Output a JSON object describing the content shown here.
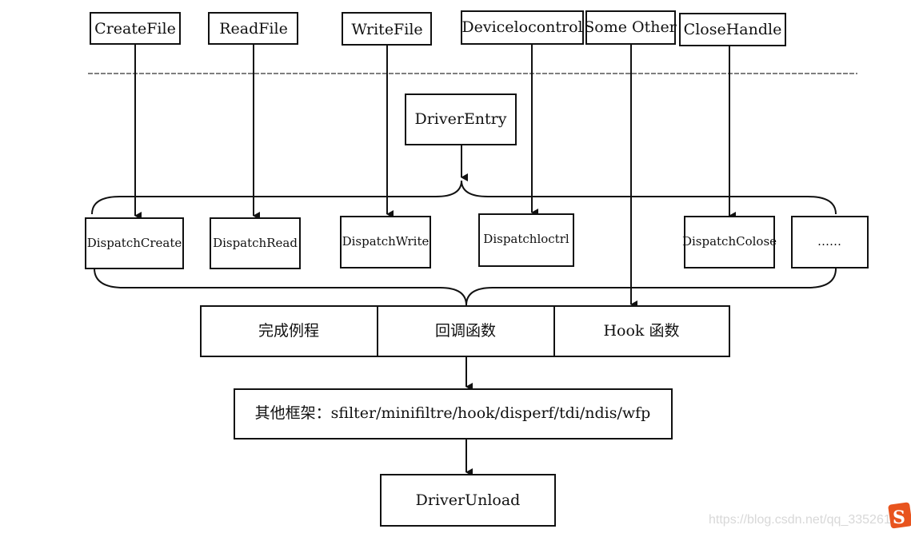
{
  "api_calls": [
    "CreateFile",
    "ReadFile",
    "WriteFile",
    "Devicelocontrol",
    "Some Other",
    "CloseHandle"
  ],
  "driver_entry": "DriverEntry",
  "dispatch": [
    "DispatchCreate",
    "DispatchRead",
    "DispatchWrite",
    "Dispatchloctrl",
    "DispatchColose",
    "……"
  ],
  "routines": [
    "完成例程",
    "回调函数",
    "Hook 函数"
  ],
  "frameworks": "其他框架：sfilter/minifiltre/hook/disperf/tdi/ndis/wfp",
  "driver_unload": "DriverUnload",
  "watermark": "https://blog.csdn.net/qq_33526144",
  "colors": {
    "line": "#111111",
    "watermark_logo": "#e8541e"
  }
}
